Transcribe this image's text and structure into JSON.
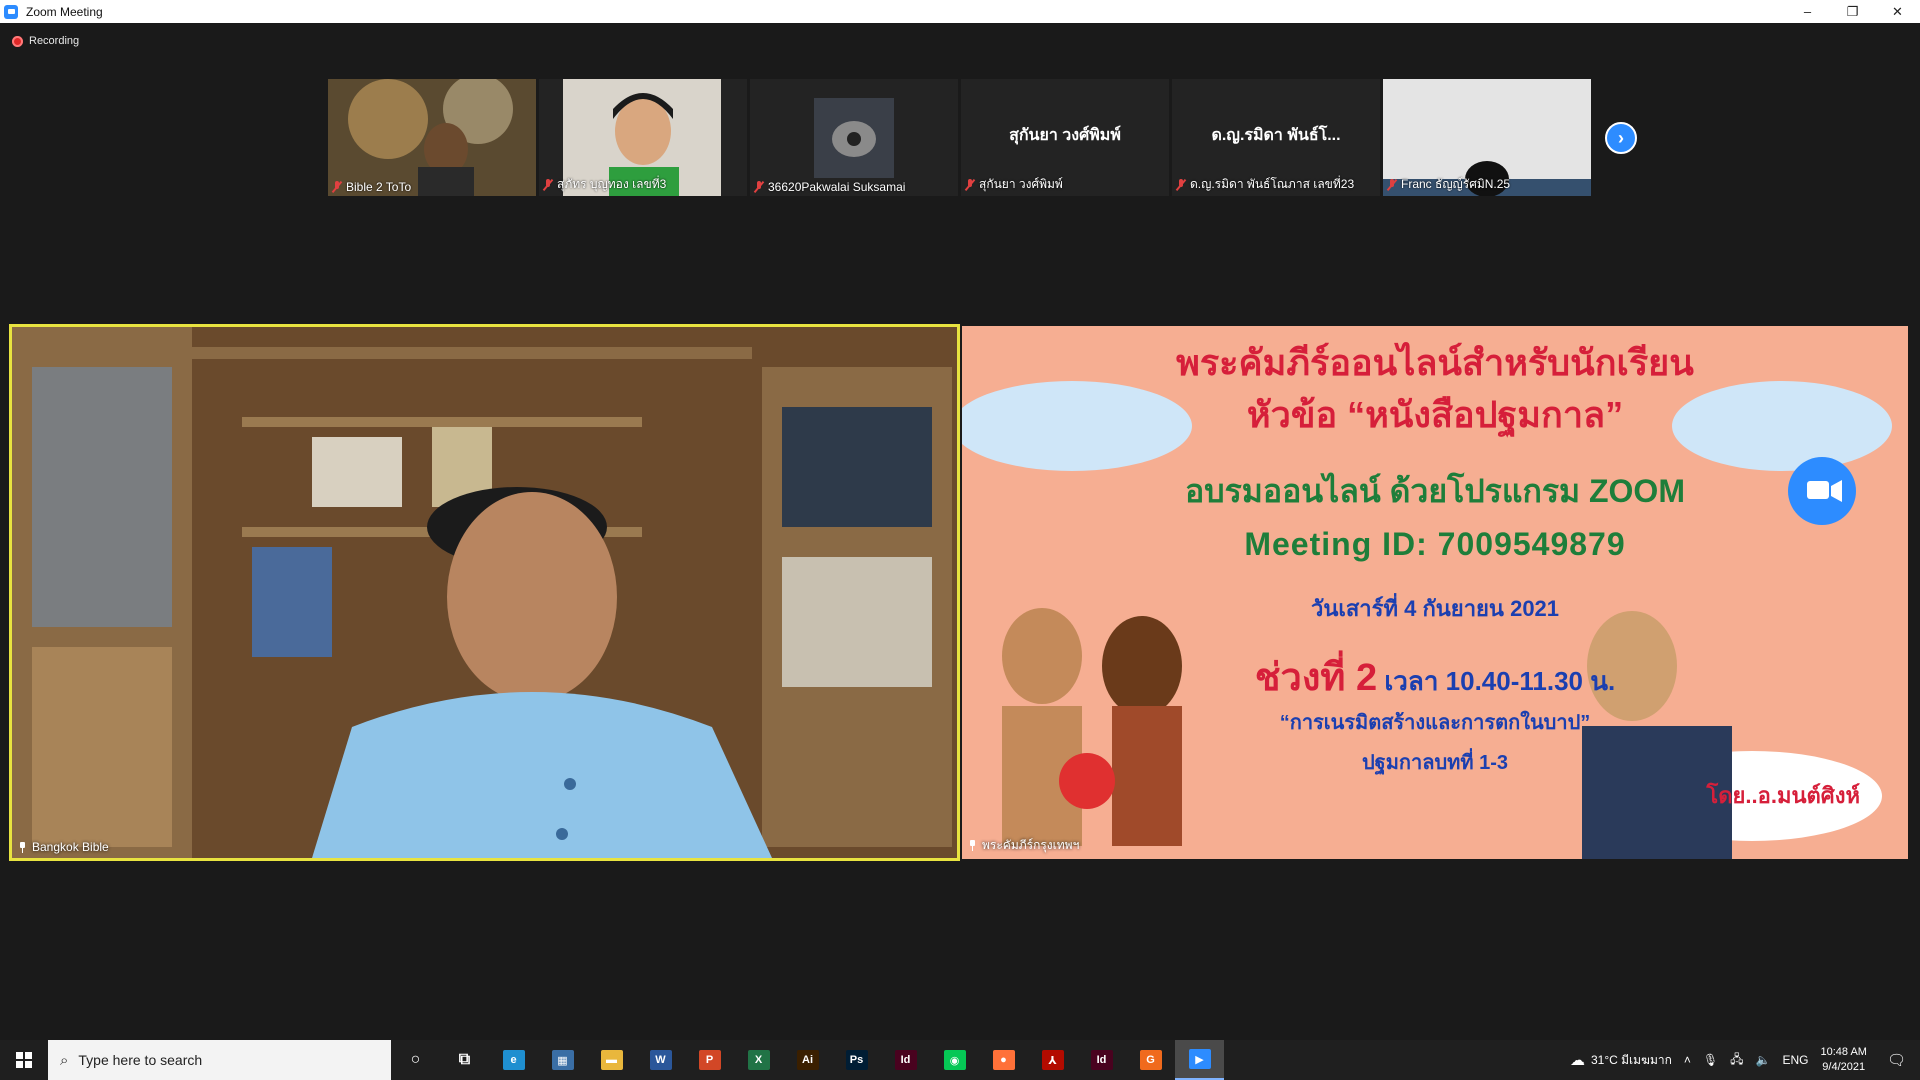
{
  "window": {
    "title": "Zoom Meeting",
    "minimize": "–",
    "restore": "❐",
    "close": "✕"
  },
  "recording": {
    "label": "Recording"
  },
  "gallery": {
    "tiles": [
      {
        "name": "Bible 2 ToTo",
        "center_name": "",
        "bg": "#6b5a3a"
      },
      {
        "name": "สุภัทร  บุญทอง เลขที่3",
        "center_name": "",
        "bg": "#d8d4cc"
      },
      {
        "name": "36620Pakwalai Suksamai",
        "center_name": "",
        "bg": "#232323"
      },
      {
        "name": "สุกันยา วงศ์พิมพ์",
        "center_name": "สุกันยา วงศ์พิมพ์",
        "bg": "#232323"
      },
      {
        "name": "ด.ญ.รมิดา พันธ์โณภาส เลขที่23",
        "center_name": "ด.ญ.รมิดา พันธ์โ...",
        "bg": "#232323"
      },
      {
        "name": "Franc ธัญญ์รัศมิN.25",
        "center_name": "",
        "bg": "#e6e6e6"
      }
    ],
    "next_icon": "›"
  },
  "main": {
    "left_label": "Bangkok Bible",
    "right_label": "พระคัมภีร์กรุงเทพฯ",
    "slide": {
      "line1": "พระคัมภีร์ออนไลน์สำหรับนักเรียน",
      "line2": "หัวข้อ “หนังสือปฐมกาล”",
      "line3": "อบรมออนไลน์ ด้วยโปรแกรม ZOOM",
      "line4": "Meeting ID: 7009549879",
      "line5": "วันเสาร์ที่ 4 กันยายน 2021",
      "line6_big": "ช่วงที่ 2",
      "line6_rest": " เวลา 10.40-11.30 น.",
      "line7": "“การเนรมิตสร้างและการตกในบาป”",
      "line8": "ปฐมกาลบทที่ 1-3",
      "byline": "โดย..อ.มนต์ศิงห์"
    }
  },
  "taskbar": {
    "search_placeholder": "Type here to search",
    "apps": [
      {
        "name": "cortana-icon",
        "glyph": "○",
        "color": "transparent"
      },
      {
        "name": "task-view-icon",
        "glyph": "⧉",
        "color": "transparent"
      },
      {
        "name": "edge-icon",
        "glyph": "e",
        "color": "#1f8fd0"
      },
      {
        "name": "calculator-icon",
        "glyph": "▦",
        "color": "#3a6ea5"
      },
      {
        "name": "file-explorer-icon",
        "glyph": "▬",
        "color": "#e9b73c"
      },
      {
        "name": "word-icon",
        "glyph": "W",
        "color": "#2b579a"
      },
      {
        "name": "powerpoint-icon",
        "glyph": "P",
        "color": "#d24726"
      },
      {
        "name": "excel-icon",
        "glyph": "X",
        "color": "#217346"
      },
      {
        "name": "illustrator-icon",
        "glyph": "Ai",
        "color": "#3a1f00"
      },
      {
        "name": "photoshop-icon",
        "glyph": "Ps",
        "color": "#001d34"
      },
      {
        "name": "indesign-icon",
        "glyph": "Id",
        "color": "#49021f"
      },
      {
        "name": "line-icon",
        "glyph": "◉",
        "color": "#06c755"
      },
      {
        "name": "firefox-icon",
        "glyph": "●",
        "color": "#ff7139"
      },
      {
        "name": "acrobat-icon",
        "glyph": "⅄",
        "color": "#b30b00"
      },
      {
        "name": "indesign-2-icon",
        "glyph": "Id",
        "color": "#49021f"
      },
      {
        "name": "shield-app-icon",
        "glyph": "G",
        "color": "#f06a1d"
      },
      {
        "name": "zoom-icon",
        "glyph": "▶",
        "color": "#2d8cff"
      }
    ],
    "weather": "31°C  มีเมฆมาก",
    "language": "ENG",
    "time": "10:48 AM",
    "date": "9/4/2021"
  }
}
